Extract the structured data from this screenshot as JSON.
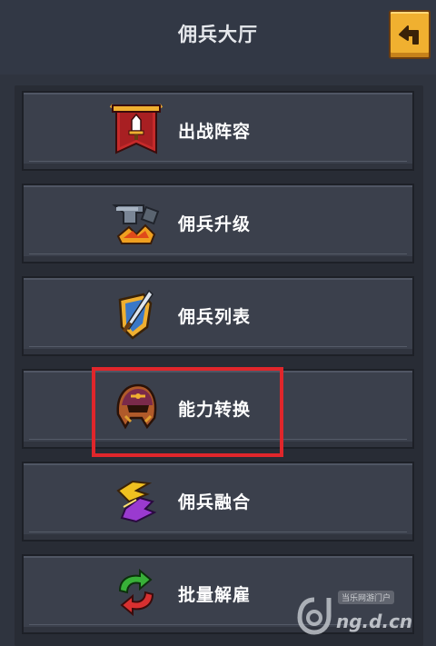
{
  "header": {
    "title": "佣兵大厅"
  },
  "menu": {
    "items": [
      {
        "label": "出战阵容",
        "icon": "banner-sword-icon"
      },
      {
        "label": "佣兵升级",
        "icon": "anvil-icon"
      },
      {
        "label": "佣兵列表",
        "icon": "shield-sword-icon"
      },
      {
        "label": "能力转换",
        "icon": "helmet-icon"
      },
      {
        "label": "佣兵融合",
        "icon": "fusion-icon"
      },
      {
        "label": "批量解雇",
        "icon": "recycle-arrows-icon"
      }
    ]
  },
  "watermark": {
    "tagline": "当乐网游门户",
    "domain": "ng.d.cn"
  },
  "colors": {
    "accent": "#f0b030",
    "highlight": "#e0262b",
    "background": "#2f343f"
  }
}
